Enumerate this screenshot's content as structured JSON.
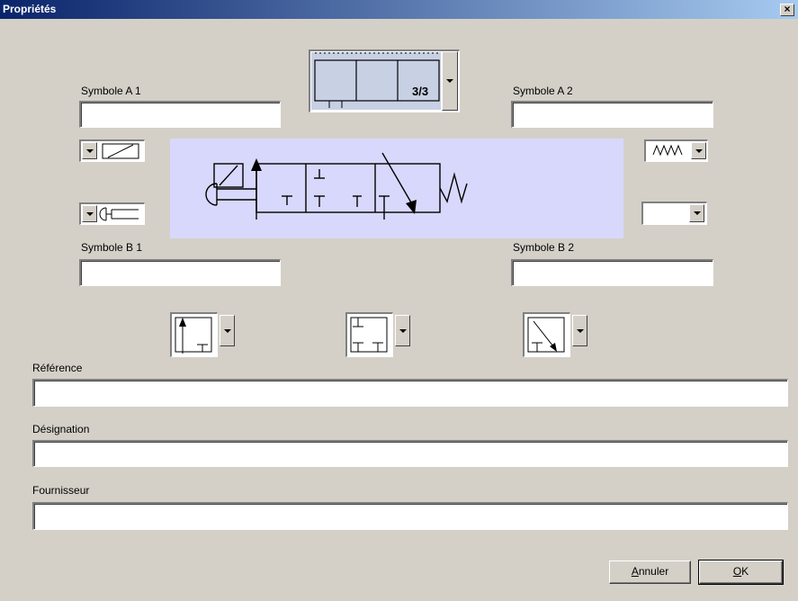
{
  "window": {
    "title": "Propriétés",
    "close_glyph": "×"
  },
  "symbols": {
    "a1_label": "Symbole A 1",
    "a2_label": "Symbole A 2",
    "b1_label": "Symbole B 1",
    "b2_label": "Symbole B 2",
    "a1_value": "",
    "a2_value": "",
    "b1_value": "",
    "b2_value": ""
  },
  "valve_type": {
    "label": "3/3"
  },
  "fields": {
    "reference_label": "Référence",
    "designation_label": "Désignation",
    "fournisseur_label": "Fournisseur",
    "reference_value": "",
    "designation_value": "",
    "fournisseur_value": ""
  },
  "buttons": {
    "cancel_accel": "A",
    "cancel_rest": "nnuler",
    "ok_accel": "O",
    "ok_rest": "K"
  },
  "icons": {
    "actuator_a1": "solenoid-icon",
    "actuator_b1": "push-button-icon",
    "actuator_a2": "spring-icon",
    "actuator_b2": "none",
    "position_1": "flow-up-icon",
    "position_2": "closed-ports-icon",
    "position_3": "flow-diagonal-icon"
  },
  "colors": {
    "titlebar_start": "#0a246a",
    "titlebar_end": "#a6caf0",
    "dialog_bg": "#d4d0c8",
    "preview_bg": "#d8d8fc",
    "selection_bg": "#c8d0e4"
  }
}
